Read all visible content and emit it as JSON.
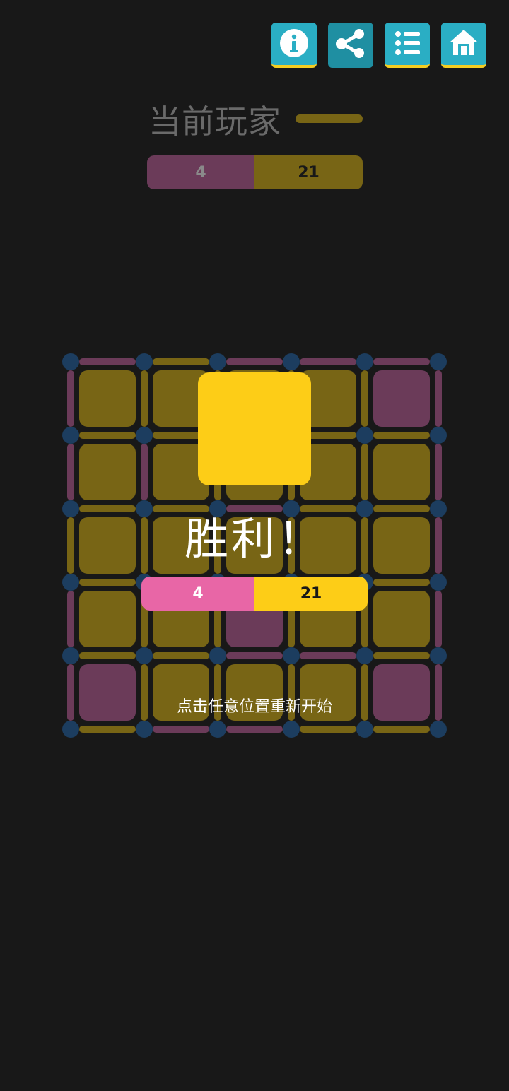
{
  "toolbar": {
    "info_icon": "info-icon",
    "share_icon": "share-icon",
    "list_icon": "list-icon",
    "home_icon": "home-icon"
  },
  "header": {
    "current_player_label": "当前玩家",
    "current_player_color": "#786515"
  },
  "scoreboard": {
    "player1_score": "4",
    "player2_score": "21"
  },
  "board": {
    "rows": 5,
    "cols": 5,
    "cell_owners": [
      [
        2,
        2,
        2,
        2,
        1
      ],
      [
        2,
        2,
        2,
        2,
        2
      ],
      [
        2,
        2,
        2,
        2,
        2
      ],
      [
        2,
        2,
        1,
        2,
        2
      ],
      [
        1,
        2,
        2,
        2,
        1
      ]
    ],
    "horizontal_edges": [
      [
        1,
        2,
        1,
        1,
        1
      ],
      [
        2,
        2,
        2,
        2,
        2
      ],
      [
        2,
        2,
        1,
        2,
        2
      ],
      [
        2,
        2,
        2,
        2,
        2
      ],
      [
        2,
        2,
        1,
        1,
        2
      ],
      [
        2,
        1,
        1,
        2,
        2
      ]
    ],
    "vertical_edges": [
      [
        1,
        2,
        2,
        2,
        2,
        1
      ],
      [
        1,
        1,
        2,
        2,
        2,
        1
      ],
      [
        2,
        2,
        2,
        2,
        2,
        1
      ],
      [
        1,
        2,
        2,
        2,
        2,
        1
      ],
      [
        1,
        2,
        2,
        2,
        2,
        1
      ]
    ]
  },
  "colors": {
    "player1": "#e866a6",
    "player2": "#fdcd17",
    "player1_dim": "#6b3b59",
    "player2_dim": "#786515",
    "dot": "#1c3d5f",
    "background": "#181818",
    "toolbar_button": "#2aaec4"
  },
  "overlay": {
    "title": "胜利！",
    "winner_color": "#fdcd17",
    "player1_score": "4",
    "player2_score": "21",
    "restart_hint": "点击任意位置重新开始"
  }
}
